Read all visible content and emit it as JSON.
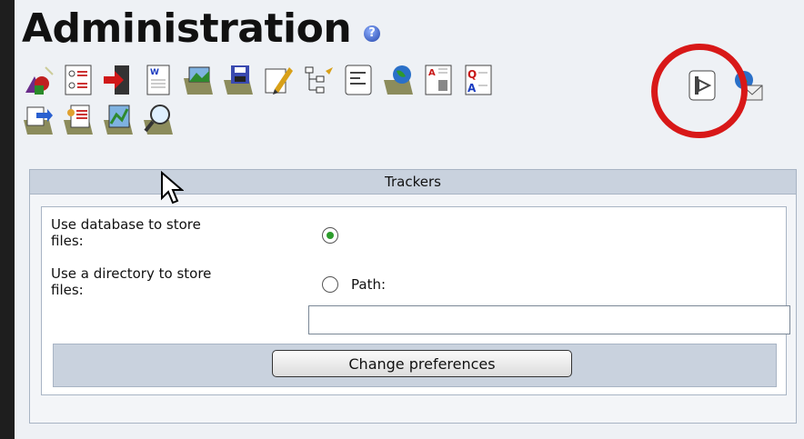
{
  "title": "Administration",
  "help_icon": "?",
  "toolbar_icons": [
    "shapes-icon",
    "list-icon",
    "exit-door-icon",
    "word-doc-icon",
    "image-folder-icon",
    "save-folder-icon",
    "edit-pencil-icon",
    "tree-icon",
    "text-doc-icon",
    "globe-folder-icon",
    "article-icon",
    "faq-icon",
    "trackers-icon",
    "email-globe-icon",
    "export-folder-icon",
    "user-list-folder-icon",
    "chart-folder-icon",
    "search-folder-icon"
  ],
  "panel": {
    "header": "Trackers",
    "db_label_line1": "Use database to store",
    "db_label_line2": "files:",
    "dir_label_line1": "Use a directory to store",
    "dir_label_line2": "files:",
    "path_label": "Path:",
    "path_value": "",
    "button": "Change preferences"
  },
  "colors": {
    "highlight": "#d81818",
    "header_bg": "#c9d2de"
  }
}
